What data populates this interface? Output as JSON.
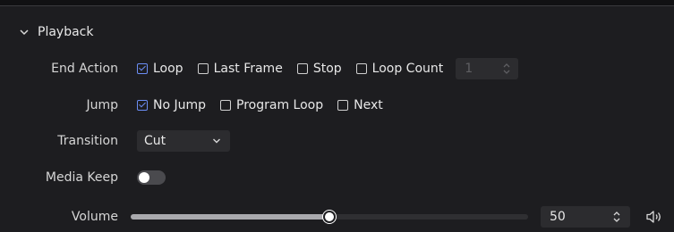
{
  "section": {
    "title": "Playback",
    "icon": "chevron-down-icon"
  },
  "end_action": {
    "label": "End Action",
    "options": [
      {
        "label": "Loop",
        "checked": true
      },
      {
        "label": "Last Frame",
        "checked": false
      },
      {
        "label": "Stop",
        "checked": false
      },
      {
        "label": "Loop Count",
        "checked": false
      }
    ],
    "loop_count_value": "1"
  },
  "jump": {
    "label": "Jump",
    "options": [
      {
        "label": "No Jump",
        "checked": true
      },
      {
        "label": "Program Loop",
        "checked": false
      },
      {
        "label": "Next",
        "checked": false
      }
    ]
  },
  "transition": {
    "label": "Transition",
    "value": "Cut"
  },
  "media_keep": {
    "label": "Media Keep",
    "on": false
  },
  "volume": {
    "label": "Volume",
    "value": "50",
    "level_percent": 50,
    "icon": "speaker-icon"
  },
  "colors": {
    "accent": "#6c8ef5",
    "background": "#1d1d20",
    "field": "#2c2c2f"
  }
}
